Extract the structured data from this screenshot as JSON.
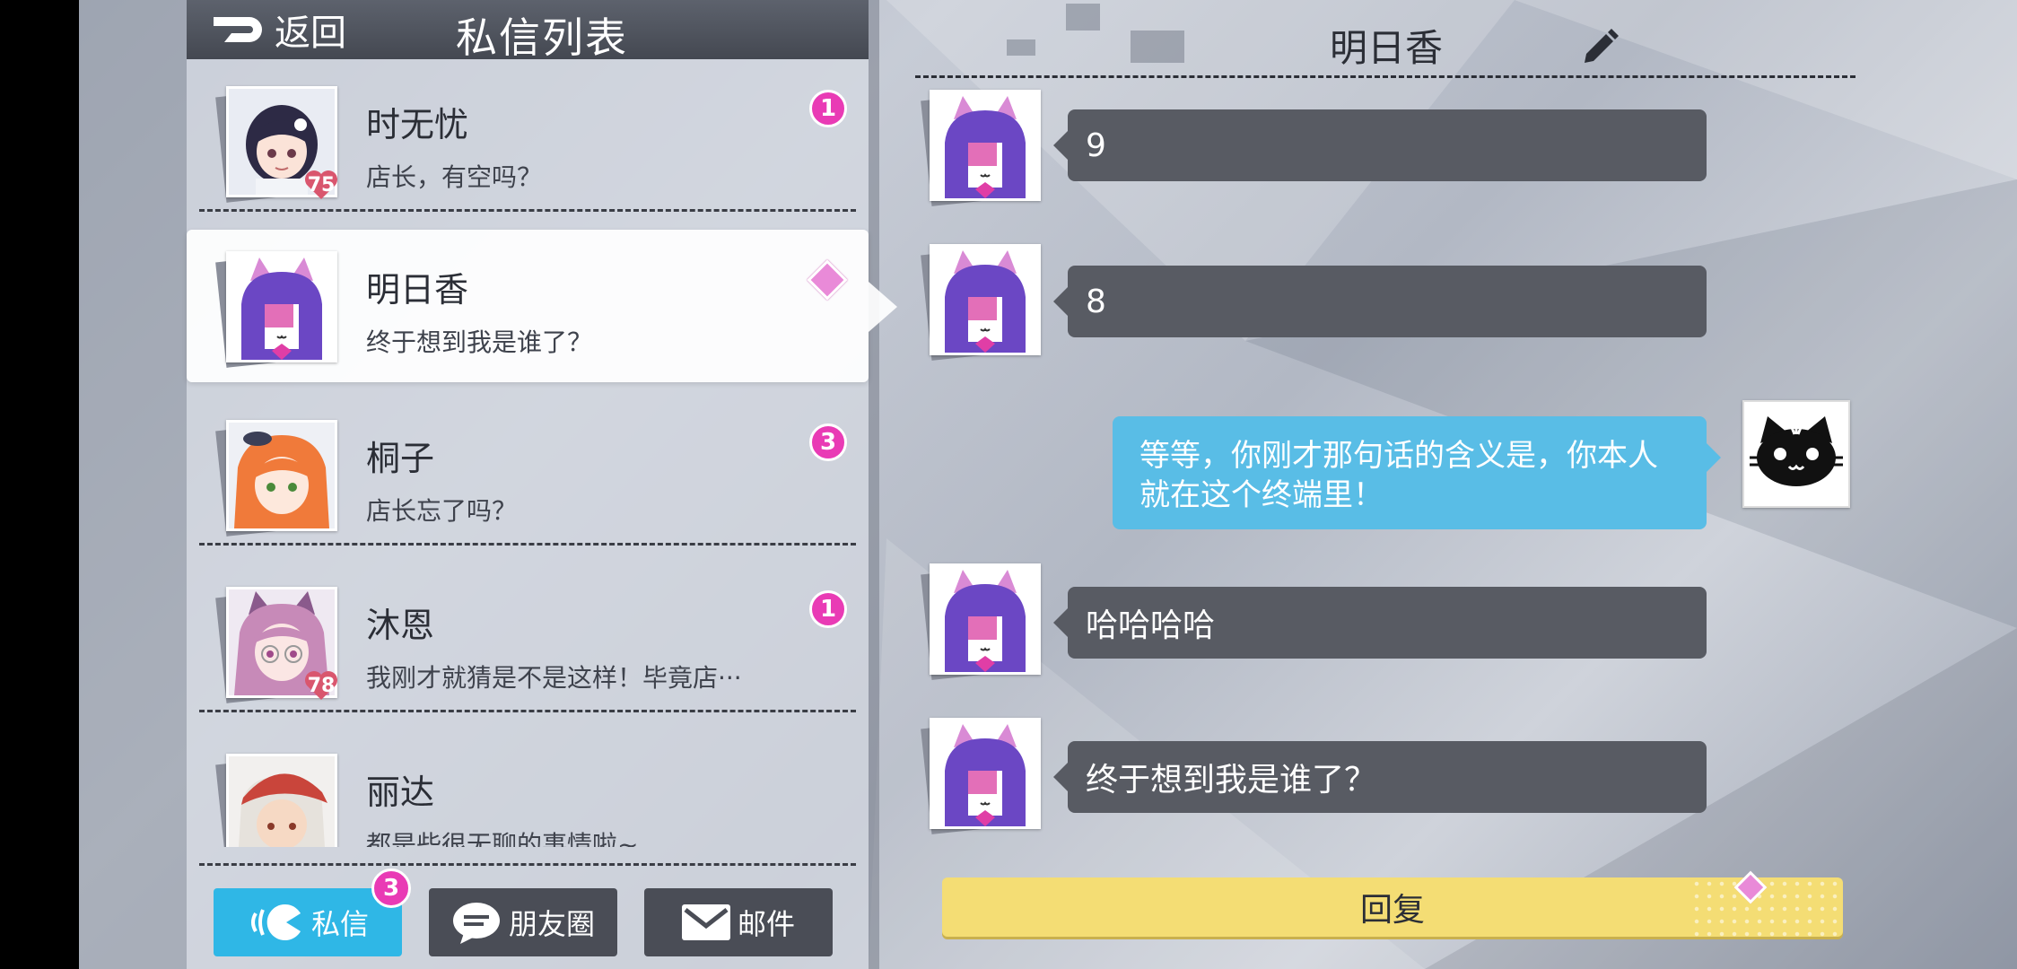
{
  "header": {
    "back_label": "返回",
    "title": "私信列表"
  },
  "conversations": [
    {
      "name": "时无忧",
      "preview": "店长，有空吗？",
      "unread": "1",
      "level": "75"
    },
    {
      "name": "明日香",
      "preview": "终于想到我是谁了？",
      "unread": "",
      "level": ""
    },
    {
      "name": "桐子",
      "preview": "店长忘了吗？",
      "unread": "3",
      "level": ""
    },
    {
      "name": "沐恩",
      "preview": "我刚才就猜是不是这样！毕竟店···",
      "unread": "1",
      "level": "78"
    },
    {
      "name": "丽达",
      "preview": "都是些很无聊的事情啦~",
      "unread": "",
      "level": ""
    }
  ],
  "tabs": [
    {
      "label": "私信",
      "badge": "3"
    },
    {
      "label": "朋友圈"
    },
    {
      "label": "邮件"
    }
  ],
  "chat": {
    "title": "明日香",
    "messages": [
      {
        "from": "them",
        "text": "9"
      },
      {
        "from": "them",
        "text": "8"
      },
      {
        "from": "me",
        "text": "等等，你刚才那句话的含义是，你本人就在这个终端里！"
      },
      {
        "from": "them",
        "text": "哈哈哈哈"
      },
      {
        "from": "them",
        "text": "终于想到我是谁了？"
      }
    ],
    "reply_label": "回复"
  },
  "colors": {
    "accent_blue": "#2fb7e6",
    "badge_pink": "#e93bb5",
    "reply_yellow": "#f4dd74",
    "bubble_gray": "#585b63",
    "bubble_blue": "#59bde6"
  }
}
